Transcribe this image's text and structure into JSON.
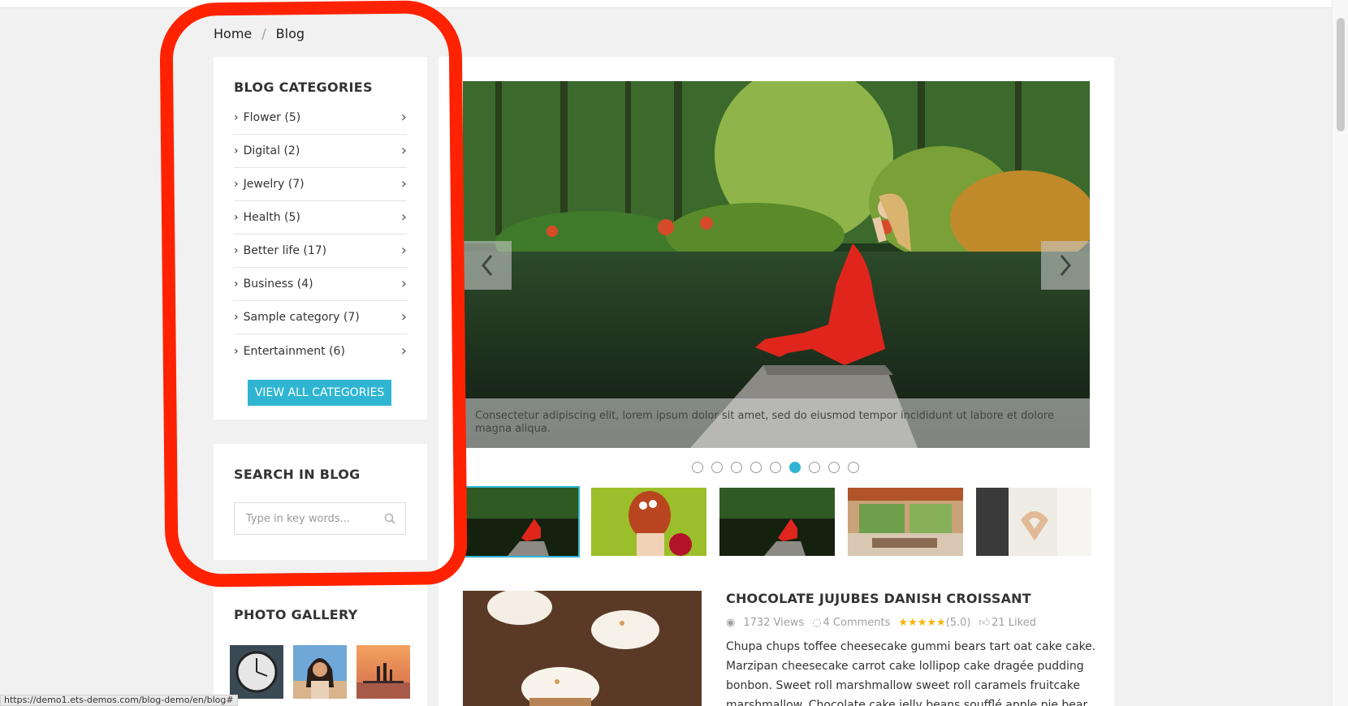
{
  "breadcrumb": {
    "home": "Home",
    "separator": "/",
    "current": "Blog"
  },
  "categories": {
    "title": "BLOG CATEGORIES",
    "items": [
      {
        "label": "Flower (5)"
      },
      {
        "label": "Digital (2)"
      },
      {
        "label": "Jewelry (7)"
      },
      {
        "label": "Health (5)"
      },
      {
        "label": "Better life (17)"
      },
      {
        "label": "Business (4)"
      },
      {
        "label": "Sample category (7)"
      },
      {
        "label": "Entertainment (6)"
      }
    ],
    "chevron": ">",
    "view_all_label": "VIEW ALL CATEGORIES"
  },
  "search": {
    "title": "SEARCH IN BLOG",
    "placeholder": "Type in key words...",
    "icon": "search-icon"
  },
  "gallery": {
    "title": "PHOTO GALLERY"
  },
  "slider": {
    "caption": "Consectetur adipiscing elit, lorem ipsum dolor sit amet, sed do eiusmod tempor incididunt ut labore et dolore magna aliqua.",
    "dot_count": 9,
    "active_dot": 6,
    "thumb_count": 5,
    "active_thumb": 1
  },
  "post": {
    "title": "CHOCOLATE JUJUBES DANISH CROISSANT",
    "views": "1732 Views",
    "comments": "4 Comments",
    "stars": "★★★★★",
    "rating": "(5.0)",
    "likes": "21 Liked",
    "excerpt": "Chupa chups toffee cheesecake gummi bears tart oat cake cake. Marzipan cheesecake carrot cake lollipop cake dragée pudding bonbon. Sweet roll marshmallow sweet roll caramels fruitcake marshmallow. Chocolate cake jelly beans soufflé apple pie bear claw"
  },
  "status_bar": {
    "url": "https://demo1.ets-demos.com/blog-demo/en/blog#"
  },
  "colors": {
    "accent": "#2fb5d2",
    "annotation": "#ff2200",
    "stars": "#f5b400"
  }
}
